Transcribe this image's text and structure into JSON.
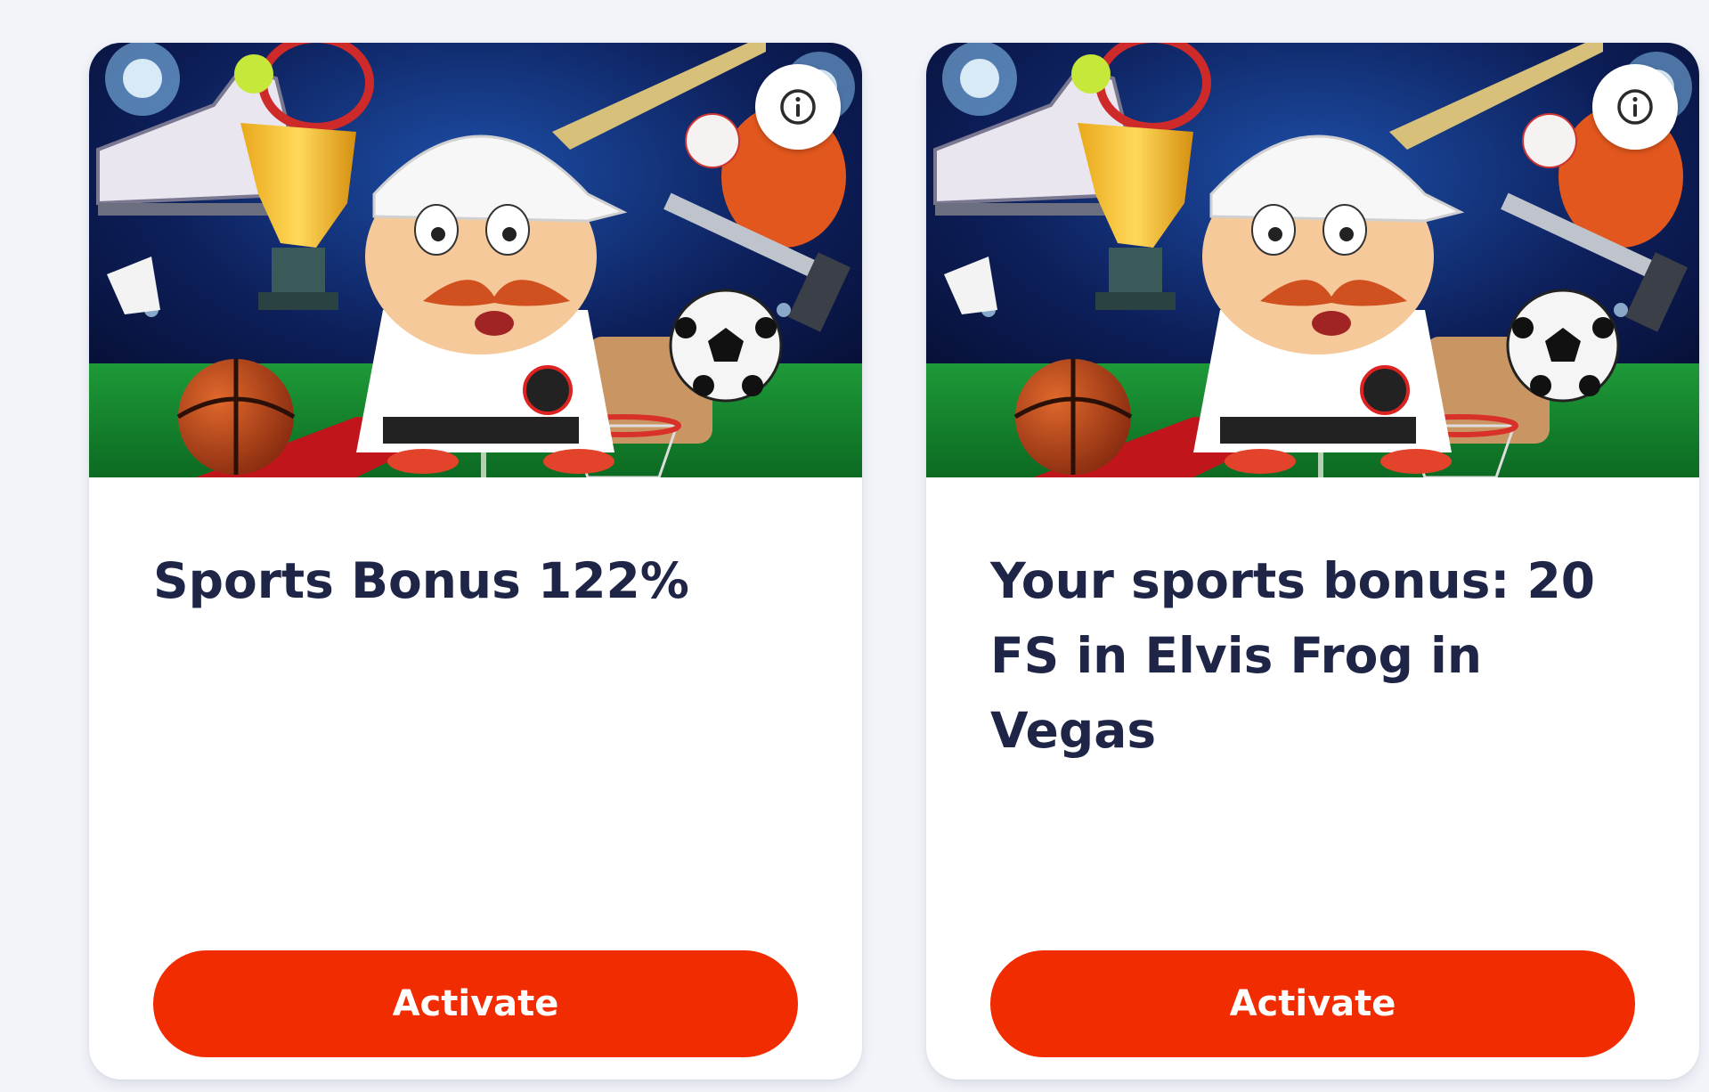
{
  "cards": [
    {
      "title": "Sports Bonus 122%",
      "button_label": "Activate",
      "banner_image": "sports-mascot-illustration",
      "info_icon": "info-icon"
    },
    {
      "title": "Your sports bonus: 20 FS in Elvis Frog in Vegas",
      "button_label": "Activate",
      "banner_image": "sports-mascot-illustration",
      "info_icon": "info-icon"
    }
  ],
  "colors": {
    "page_background": "#f2f4f9",
    "card_background": "#ffffff",
    "title_text": "#1f2547",
    "button_background": "#f12c00",
    "button_text": "#ffffff"
  }
}
